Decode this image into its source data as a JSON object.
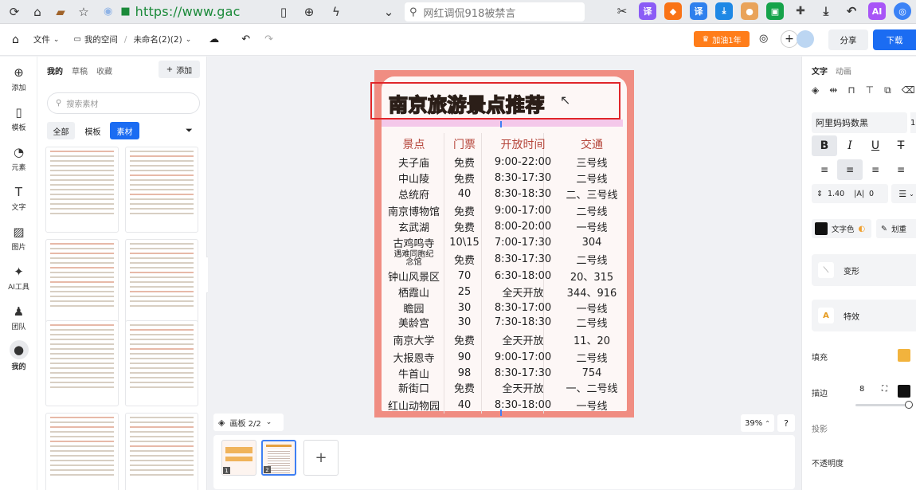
{
  "browser": {
    "url": "https://www.gac",
    "search_text": "网红调侃918被禁言",
    "ext_labels": [
      "译",
      "译",
      "AI"
    ]
  },
  "app": {
    "file_menu": "文件",
    "space": "我的空间",
    "doc_name": "未命名(2)(2)",
    "vip_btn": "加油1年",
    "share_btn": "分享",
    "download_btn": "下载"
  },
  "rail": {
    "items": [
      "添加",
      "模板",
      "元素",
      "文字",
      "图片",
      "AI工具",
      "团队",
      "我的"
    ]
  },
  "left_panel": {
    "tabs": [
      "我的",
      "草稿",
      "收藏"
    ],
    "add_btn": "添加",
    "search_placeholder": "搜索素材",
    "filters": [
      "全部",
      "模板",
      "素材"
    ]
  },
  "poster": {
    "title": "南京旅游景点推荐",
    "headers": [
      "景点",
      "门票",
      "开放时间",
      "交通"
    ],
    "rows": [
      [
        "夫子庙",
        "免费",
        "9:00-22:00",
        "三号线"
      ],
      [
        "中山陵",
        "免费",
        "8:30-17:30",
        "二号线"
      ],
      [
        "总统府",
        "40",
        "8:30-18:30",
        "二、三号线"
      ],
      [
        "南京博物馆",
        "免费",
        "9:00-17:00",
        "二号线"
      ],
      [
        "玄武湖",
        "免费",
        "8:00-20:00",
        "一号线"
      ],
      [
        "古鸡鸣寺",
        "10\\15",
        "7:00-17:30",
        "304"
      ],
      [
        "遇难同胞纪念馆",
        "免费",
        "8:30-17:30",
        "二号线"
      ],
      [
        "钟山风景区",
        "70",
        "6:30-18:00",
        "20、315"
      ],
      [
        "栖霞山",
        "25",
        "全天开放",
        "344、916"
      ],
      [
        "瞻园",
        "30",
        "8:30-17:00",
        "一号线"
      ],
      [
        "美龄宫",
        "30",
        "7:30-18:30",
        "二号线"
      ],
      [
        "南京大学",
        "免费",
        "全天开放",
        "11、20"
      ],
      [
        "大报恩寺",
        "90",
        "9:00-17:00",
        "二号线"
      ],
      [
        "牛首山",
        "98",
        "8:30-17:30",
        "754"
      ],
      [
        "新街口",
        "免费",
        "全天开放",
        "一、二号线"
      ],
      [
        "红山动物园",
        "40",
        "8:30-18:00",
        "一号线"
      ]
    ]
  },
  "canvas": {
    "page_indicator": "画板 2/2",
    "zoom": "39%",
    "help": "?",
    "page_numbers": [
      "1",
      "2"
    ]
  },
  "right_panel": {
    "tabs": [
      "文字",
      "动画"
    ],
    "font_name": "阿里妈妈数黑",
    "font_size": "1",
    "line_height": "1.40",
    "letter_spacing": "0",
    "text_color_label": "文字色",
    "stroke_label": "划重",
    "transform_label": "变形",
    "effects_label": "特效",
    "fill_label": "填充",
    "border_label": "描边",
    "border_width": "8",
    "shadow_label": "投影",
    "opacity_label": "不透明度",
    "colors": {
      "text": "#111111",
      "fill": "#f2b33d",
      "border": "#111111",
      "accent": "#1b6cf2"
    }
  }
}
